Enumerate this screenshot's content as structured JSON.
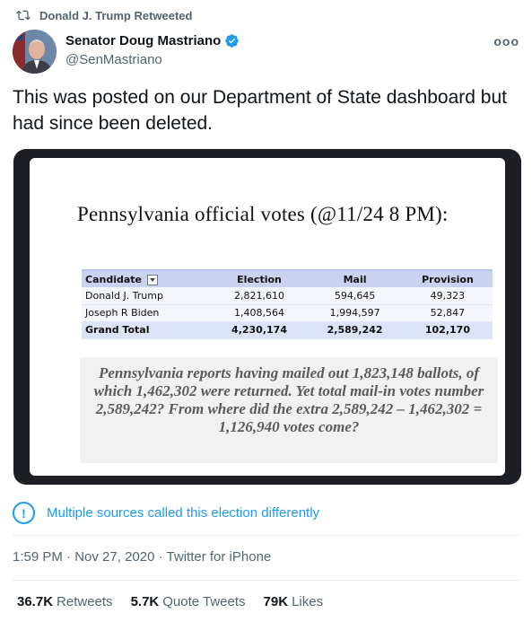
{
  "social_context": {
    "text": "Donald J. Trump Retweeted"
  },
  "author": {
    "display_name": "Senator Doug Mastriano",
    "handle": "@SenMastriano"
  },
  "more_label": "ooo",
  "tweet": {
    "text": "This was posted on our Department of State dashboard but had since been deleted."
  },
  "media": {
    "title": "Pennsylvania official votes (@11/24 8 PM):",
    "table": {
      "headers": [
        "Candidate",
        "Election",
        "Mail",
        "Provision"
      ],
      "rows": [
        [
          "Donald J. Trump",
          "2,821,610",
          "594,645",
          "49,323"
        ],
        [
          "Joseph R Biden",
          "1,408,564",
          "1,994,597",
          "52,847"
        ]
      ],
      "total": [
        "Grand Total",
        "4,230,174",
        "2,589,242",
        "102,170"
      ]
    },
    "note": "Pennsylvania reports having mailed out 1,823,148 ballots, of which 1,462,302 were returned. Yet total mail-in votes number 2,589,242? From where did the extra 2,589,242 – 1,462,302 = 1,126,940 votes come?"
  },
  "notice": {
    "text": "Multiple sources called this election differently"
  },
  "meta": {
    "time": "1:59 PM",
    "date": "Nov 27, 2020",
    "source": "Twitter for iPhone",
    "separator": "·"
  },
  "stats": {
    "retweets": {
      "count": "36.7K",
      "label": "Retweets"
    },
    "quote_tweets": {
      "count": "5.7K",
      "label": "Quote Tweets"
    },
    "likes": {
      "count": "79K",
      "label": "Likes"
    }
  },
  "colors": {
    "accent": "#1d9bf0",
    "secondary_text": "#536471",
    "primary_text": "#0f1419"
  }
}
